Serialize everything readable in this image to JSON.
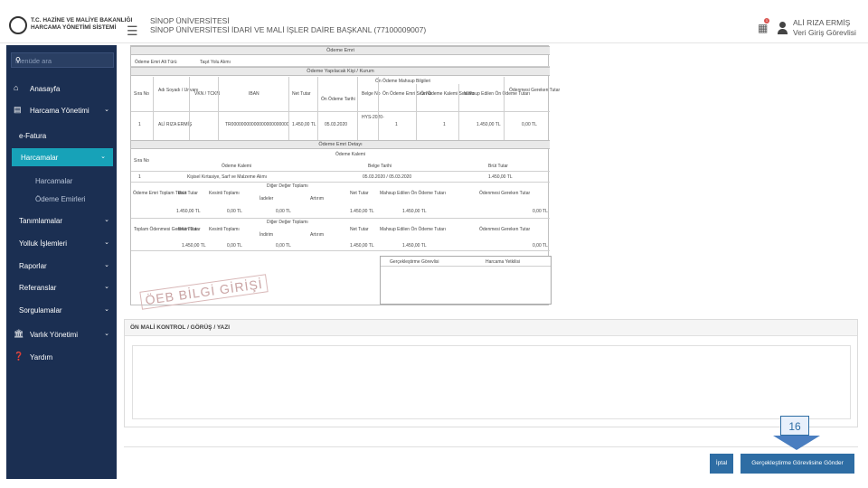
{
  "header": {
    "logo_line1": "T.C. HAZİNE VE MALİYE BAKANLIĞI",
    "logo_line2": "HARCAMA YÖNETİMİ SİSTEMİ",
    "institution_line1": "SİNOP ÜNİVERSİTESİ",
    "institution_line2": "SİNOP ÜNİVERSİTESİ İDARİ VE MALİ İŞLER DAİRE BAŞKANL (77100009007)",
    "user_name": "ALİ RIZA ERMİŞ",
    "user_role": "Veri Giriş Görevlisi",
    "notification_count": "1"
  },
  "sidebar": {
    "search_placeholder": "Menüde ara",
    "items": [
      {
        "label": "Anasayfa",
        "icon": "home-icon"
      },
      {
        "label": "Harcama Yönetimi",
        "icon": "list-icon"
      },
      {
        "label": "e-Fatura"
      },
      {
        "label": "Harcamalar"
      },
      {
        "label": "Harcamalar"
      },
      {
        "label": "Ödeme Emirleri"
      },
      {
        "label": "Tanımlamalar"
      },
      {
        "label": "Yolluk İşlemleri"
      },
      {
        "label": "Raporlar"
      },
      {
        "label": "Referanslar"
      },
      {
        "label": "Sorgulamalar"
      },
      {
        "label": "Varlık Yönetimi",
        "icon": "bank-icon"
      },
      {
        "label": "Yardım",
        "icon": "help-icon"
      }
    ]
  },
  "doc": {
    "sec_odeme_emri": "Ödeme Emri",
    "odeme_emri_alt_turu_label": "Ödeme Emri Alt Türü",
    "odeme_emri_alt_turu_value": "Taşıt Yolu Alımı",
    "sec_yapilacak_kisi": "Ödeme Yapılacak Kişi / Kurum",
    "cols1": [
      "Sıra No",
      "Adı Soyadı / Unvanı",
      "VKN / TCKN",
      "IBAN",
      "Net Tutar",
      "Ön Ödeme Tarihi",
      "Belge No",
      "Ön Ödeme Emri Sıra No",
      "Ön Ödeme Kalemi Sıra No",
      "Mahsup Edilen Ön Ödeme Tutarı",
      "Ödenmesi Gereken Tutar"
    ],
    "on_odeme_bilgileri": "Ön Ödeme Mahsup Bilgileri",
    "row1": [
      "1",
      "ALİ RIZA ERMİŞ",
      "",
      "TR00000000000000000000000",
      "1.450,00 TL",
      "05.03.2020",
      "HYS-2020-",
      "1",
      "1",
      "1.450,00 TL",
      "0,00 TL"
    ],
    "sec_emri_detay": "Ödeme Emri Detayı",
    "odeme_kalemi": "Ödeme Kalemi",
    "cols2": [
      "Sıra No",
      "Ödeme Kalemi",
      "Belge Tarihi",
      "Brüt Tutar"
    ],
    "row2": [
      "1",
      "Kişisel Kırtasiye, Sarf ve Malzeme Alımı",
      "05.03.2020 / 05.03.2020",
      "1.450,00 TL"
    ],
    "toplam_label": "Ödeme Emri Toplam Tutarı",
    "cols3": [
      "Brüt Tutar",
      "Kesinti Toplamı",
      "İadeler",
      "Artırım",
      "Net Tutar",
      "Mahsup Edilen Ön Ödeme Tutarı",
      "Ödenmesi Gereken Tutar"
    ],
    "diger_toplam": "Diğer Değer Toplamı",
    "row3": [
      "1.450,00 TL",
      "0,00 TL",
      "0,00 TL",
      "",
      "1.450,00 TL",
      "1.450,00 TL",
      "0,00 TL"
    ],
    "gereken_label": "Toplam Ödenmesi Gereken Tutar",
    "cols4": [
      "Brüt Tutar",
      "Kesinti Toplamı",
      "İndirim",
      "Artırım",
      "Net Tutar",
      "Mahsup Edilen Ön Ödeme Tutarı",
      "Ödenmesi Gereken Tutar"
    ],
    "diger_toplam2": "Diğer Değer Toplamı",
    "row4": [
      "1.450,00 TL",
      "0,00 TL",
      "0,00 TL",
      "",
      "1.450,00 TL",
      "1.450,00 TL",
      "0,00 TL"
    ],
    "sig_col1": "Gerçekleştirme Görevlisi",
    "sig_col2": "Harcama Yetkilisi",
    "watermark": "ÖEB BİLGİ GİRİŞİ"
  },
  "panel": {
    "title": "ÖN MALİ KONTROL / GÖRÜŞ / YAZI"
  },
  "actions": {
    "cancel": "İptal",
    "send": "Gerçekleştirme Görevlisine Gönder"
  },
  "callout": {
    "number": "16"
  },
  "colors": {
    "sidebar_bg": "#1b2f52",
    "active_item": "#17a2b8",
    "button": "#2e6da4"
  }
}
